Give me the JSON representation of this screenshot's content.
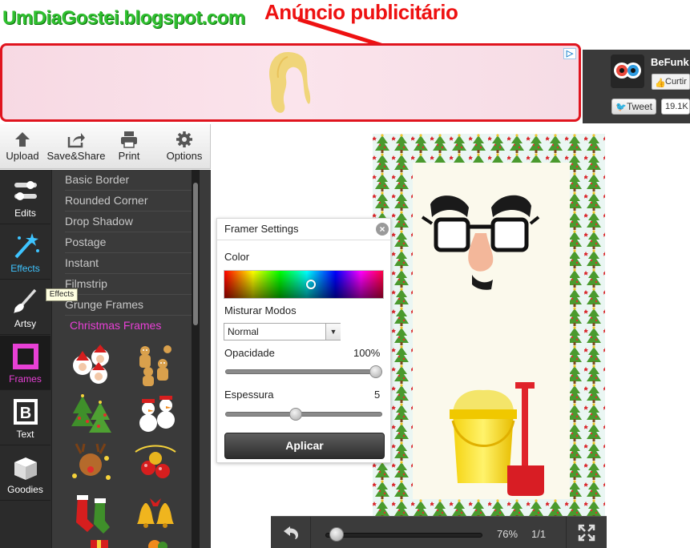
{
  "annotations": {
    "site_title": "UmDiaGostei.blogspot.com",
    "ad_label": "Anúncio publicitário"
  },
  "ad": {
    "choice_icon": "adchoices-icon"
  },
  "social": {
    "name": "BeFunk",
    "like_label": "Curtir",
    "tweet_label": "Tweet",
    "tweet_count": "19.1K"
  },
  "toolbar": {
    "upload": "Upload",
    "save_share": "Save&Share",
    "print": "Print",
    "options": "Options"
  },
  "rail": {
    "edits": "Edits",
    "effects": "Effects",
    "artsy": "Artsy",
    "frames": "Frames",
    "text": "Text",
    "goodies": "Goodies"
  },
  "frames_list": [
    "Basic Border",
    "Rounded Corner",
    "Drop Shadow",
    "Postage",
    "Instant",
    "Filmstrip",
    "Grunge Frames",
    "Christmas Frames"
  ],
  "tooltip": "Effects",
  "dialog": {
    "title": "Framer Settings",
    "color_label": "Color",
    "blend_label": "Misturar Modos",
    "blend_value": "Normal",
    "opacity_label": "Opacidade",
    "opacity_value": "100%",
    "thickness_label": "Espessura",
    "thickness_value": "5",
    "apply_label": "Aplicar"
  },
  "bottom_bar": {
    "zoom": "76%",
    "page": "1/1"
  },
  "colors": {
    "accent_pink": "#e840d6",
    "accent_blue": "#3ec4ff",
    "annotation_red": "#ee1111",
    "title_green": "#2fc02f"
  }
}
